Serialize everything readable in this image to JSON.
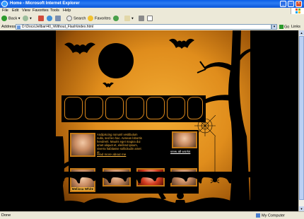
{
  "window": {
    "title": "Home - Microsoft Internet Explorer"
  },
  "menu": {
    "items": [
      "File",
      "Edit",
      "View",
      "Favorites",
      "Tools",
      "Help"
    ]
  },
  "toolbar": {
    "back": "Back",
    "search": "Search",
    "favorites": "Favorites"
  },
  "address": {
    "label": "Address",
    "url": "D:\\Docs\\Jellbar\\40_\\Without_Flash\\index.html",
    "go": "Go",
    "links": "Links"
  },
  "content": {
    "about_text": "Andipiscing nonuml vestibulum nulla, sed leo hac. Aenean lobortis hendrerit. Mauris eget magna dui amet aliquet et, eleifend ipsum, viverra habitasse sollicitudin amet at.",
    "more_link": "read more about me",
    "artworks_link": "view all works",
    "profile_name": "Melissa White"
  },
  "status": {
    "left": "Done",
    "zone": "My Computer"
  },
  "colors": {
    "accent_orange": "#e08d1c",
    "tab_border": "#d9861c",
    "text_orange": "#f4b23c"
  }
}
